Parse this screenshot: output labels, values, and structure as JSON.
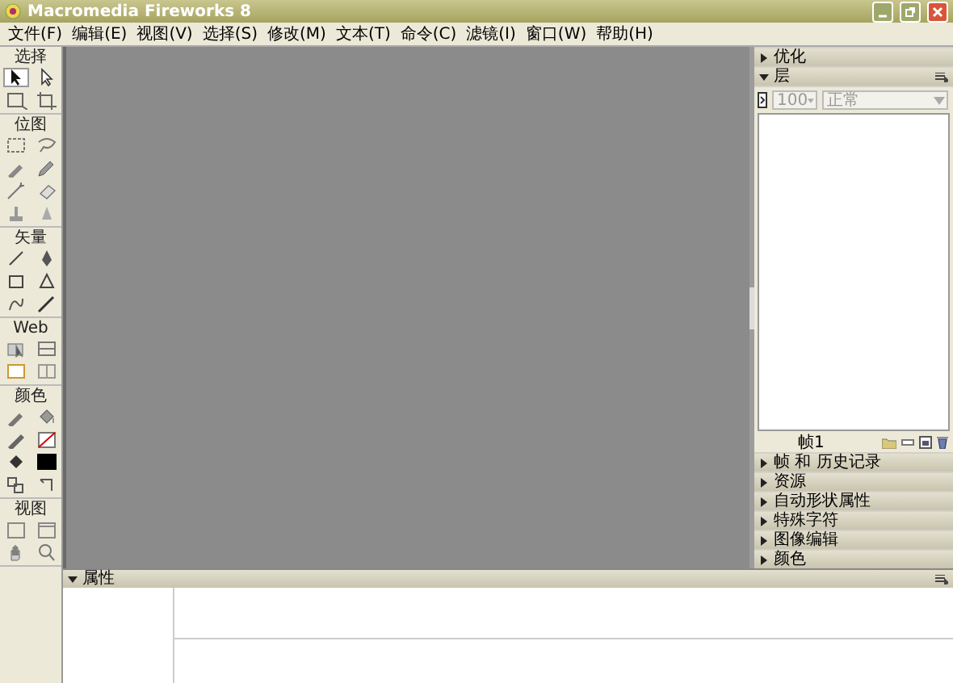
{
  "window": {
    "title": "Macromedia Fireworks 8"
  },
  "menu": [
    "文件(F)",
    "编辑(E)",
    "视图(V)",
    "选择(S)",
    "修改(M)",
    "文本(T)",
    "命令(C)",
    "滤镜(I)",
    "窗口(W)",
    "帮助(H)"
  ],
  "tools": {
    "sections": [
      {
        "title": "选择"
      },
      {
        "title": "位图"
      },
      {
        "title": "矢量"
      },
      {
        "title": "Web"
      },
      {
        "title": "颜色"
      },
      {
        "title": "视图"
      }
    ]
  },
  "panels": [
    {
      "kind": "plain",
      "title": "优化",
      "expanded": false
    },
    {
      "kind": "layers",
      "title": "层",
      "expanded": true,
      "opacity": "100",
      "blend": "正常",
      "disabled": true,
      "footer": "帧1"
    },
    {
      "kind": "plain",
      "title": "帧 和 历史记录",
      "expanded": false
    },
    {
      "kind": "plain",
      "title": "资源",
      "expanded": false
    },
    {
      "kind": "plain",
      "title": "自动形状属性",
      "expanded": false
    },
    {
      "kind": "plain",
      "title": "特殊字符",
      "expanded": false
    },
    {
      "kind": "plain",
      "title": "图像编辑",
      "expanded": false
    },
    {
      "kind": "plain",
      "title": "颜色",
      "expanded": false
    }
  ],
  "properties": {
    "title": "属性",
    "expanded": true
  }
}
